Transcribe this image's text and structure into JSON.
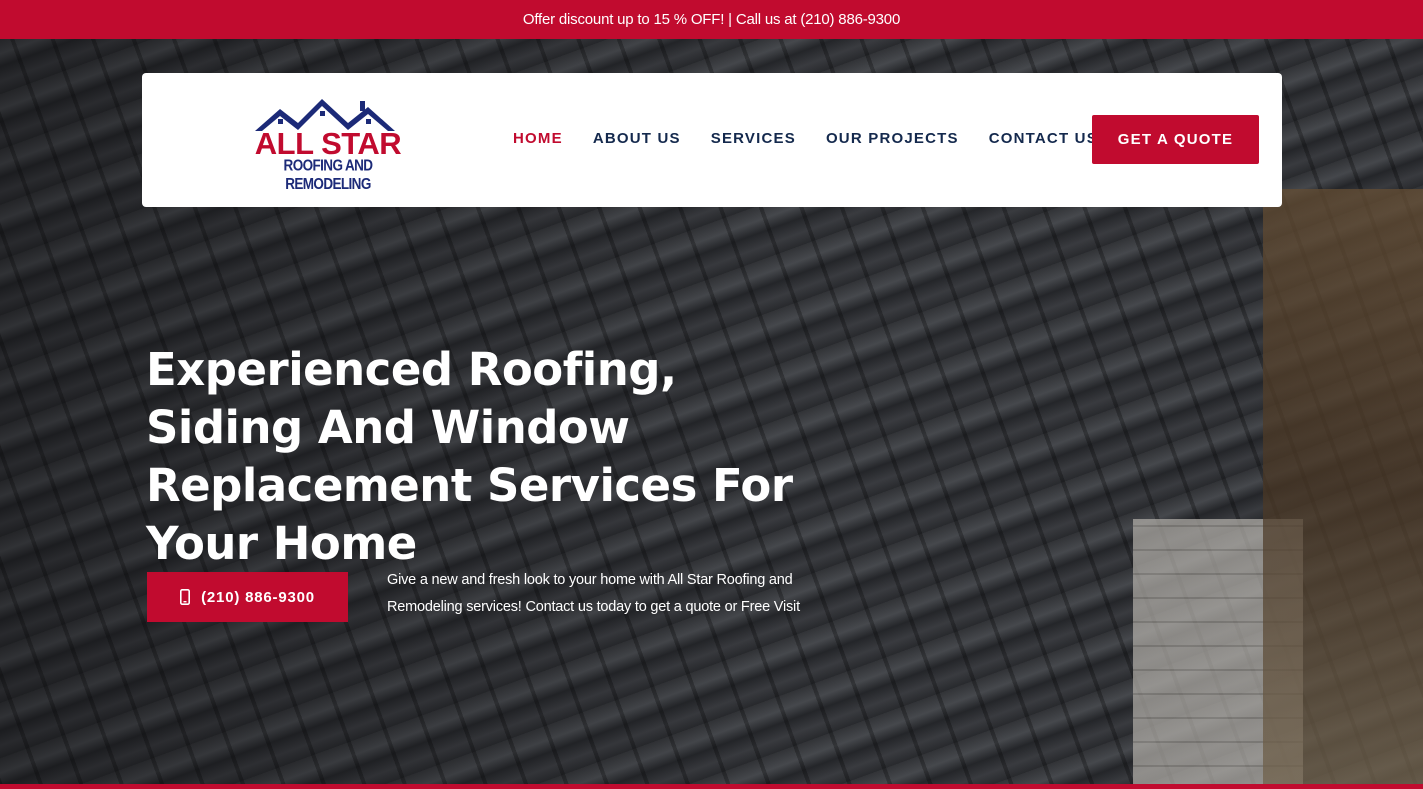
{
  "topbar": {
    "text": "Offer discount up to 15 % OFF! | Call us at (210) 886-9300"
  },
  "logo": {
    "main": "ALL STAR",
    "sub": "ROOFING AND REMODELING"
  },
  "nav": {
    "items": [
      {
        "label": "HOME",
        "active": true
      },
      {
        "label": "ABOUT US",
        "active": false
      },
      {
        "label": "SERVICES",
        "active": false
      },
      {
        "label": "OUR PROJECTS",
        "active": false
      },
      {
        "label": "CONTACT US",
        "active": false
      }
    ],
    "cta_label": "GET A QUOTE"
  },
  "hero": {
    "headline": "Experienced Roofing, Siding And Window Replacement Services For Your Home",
    "phone_button_label": "(210) 886-9300",
    "intro": "Give a new and fresh look to your home with All Star Roofing and Remodeling services! Contact us today to get a quote or Free Visit"
  },
  "colors": {
    "brand_red": "#c10b2f",
    "navy": "#14294d",
    "logo_blue": "#1c2a78"
  },
  "icons": {
    "phone_button": "mobile-phone-icon",
    "logo_roof": "house-roof-icon"
  }
}
